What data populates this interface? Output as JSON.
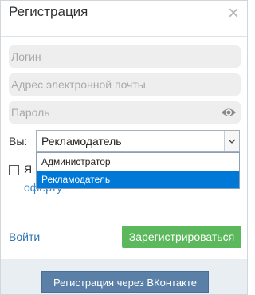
{
  "dialog": {
    "title": "Регистрация",
    "close_icon": "close-icon"
  },
  "form": {
    "login_placeholder": "Логин",
    "email_placeholder": "Адрес электронной почты",
    "password_placeholder": "Пароль",
    "password_icon": "eye-icon",
    "role_label": "Вы:",
    "role_selected": "Рекламодатель",
    "role_options": [
      "Администратор",
      "Рекламодатель"
    ],
    "agree_text": "Я",
    "offer_link": "оферту"
  },
  "actions": {
    "login_link": "Войти",
    "register_button": "Зарегистрироваться"
  },
  "footer": {
    "vk_button": "Регистрация через ВКонтакте"
  },
  "colors": {
    "accent_green": "#5cb85c",
    "selection_blue": "#0078d7",
    "vk_blue": "#5a80a8",
    "link_blue": "#2f76b4"
  }
}
